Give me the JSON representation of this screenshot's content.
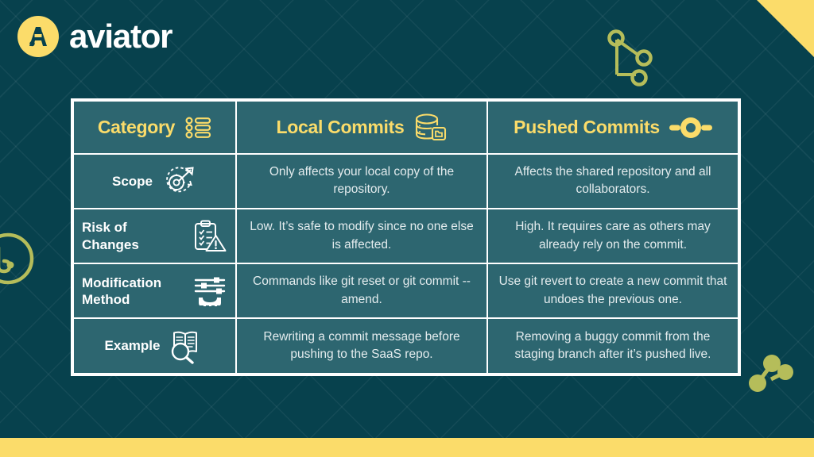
{
  "brand": {
    "name": "aviator",
    "logo_icon": "aviator-a-mark-icon",
    "logo_bg": "#fbdc6a",
    "wordmark_color": "#ffffff"
  },
  "theme": {
    "page_bg": "#07414d",
    "cell_bg": "#2d6670",
    "accent_yellow": "#fbdc6a",
    "border_white": "#ffffff",
    "deco_olive": "#b5bd5a",
    "body_text": "#e4ecee"
  },
  "decorations": [
    {
      "name": "git-branch-graph-outline-icon",
      "position": "top-right"
    },
    {
      "name": "git-merge-graph-solid-icon",
      "position": "right-lower"
    },
    {
      "name": "aviator-circle-mark-icon",
      "position": "left-edge"
    },
    {
      "name": "corner-triangle",
      "position": "top-right-corner"
    },
    {
      "name": "bottom-accent-bar",
      "position": "bottom"
    }
  ],
  "table": {
    "headers": [
      {
        "label": "Category",
        "icon": "bullet-list-icon"
      },
      {
        "label": "Local Commits",
        "icon": "database-folder-icon"
      },
      {
        "label": "Pushed Commits",
        "icon": "commit-node-icon"
      }
    ],
    "rows": [
      {
        "label": "Scope",
        "icon": "target-gear-arrow-icon",
        "local": "Only affects your local copy of the repository.",
        "pushed": "Affects the shared repository and all collaborators."
      },
      {
        "label": "Risk of Changes",
        "icon": "clipboard-warning-icon",
        "local": "Low. It’s safe to modify since no one else is affected.",
        "pushed": "High. It requires care as others may already rely on the commit."
      },
      {
        "label": "Modification Method",
        "icon": "sliders-gear-icon",
        "local": "Commands like git reset or git commit --amend.",
        "pushed": "Use git revert to create a new commit that undoes the previous one."
      },
      {
        "label": "Example",
        "icon": "book-magnifier-icon",
        "local": "Rewriting a commit message before pushing to the SaaS repo.",
        "pushed": "Removing a buggy commit from the staging branch after it’s pushed live."
      }
    ]
  }
}
